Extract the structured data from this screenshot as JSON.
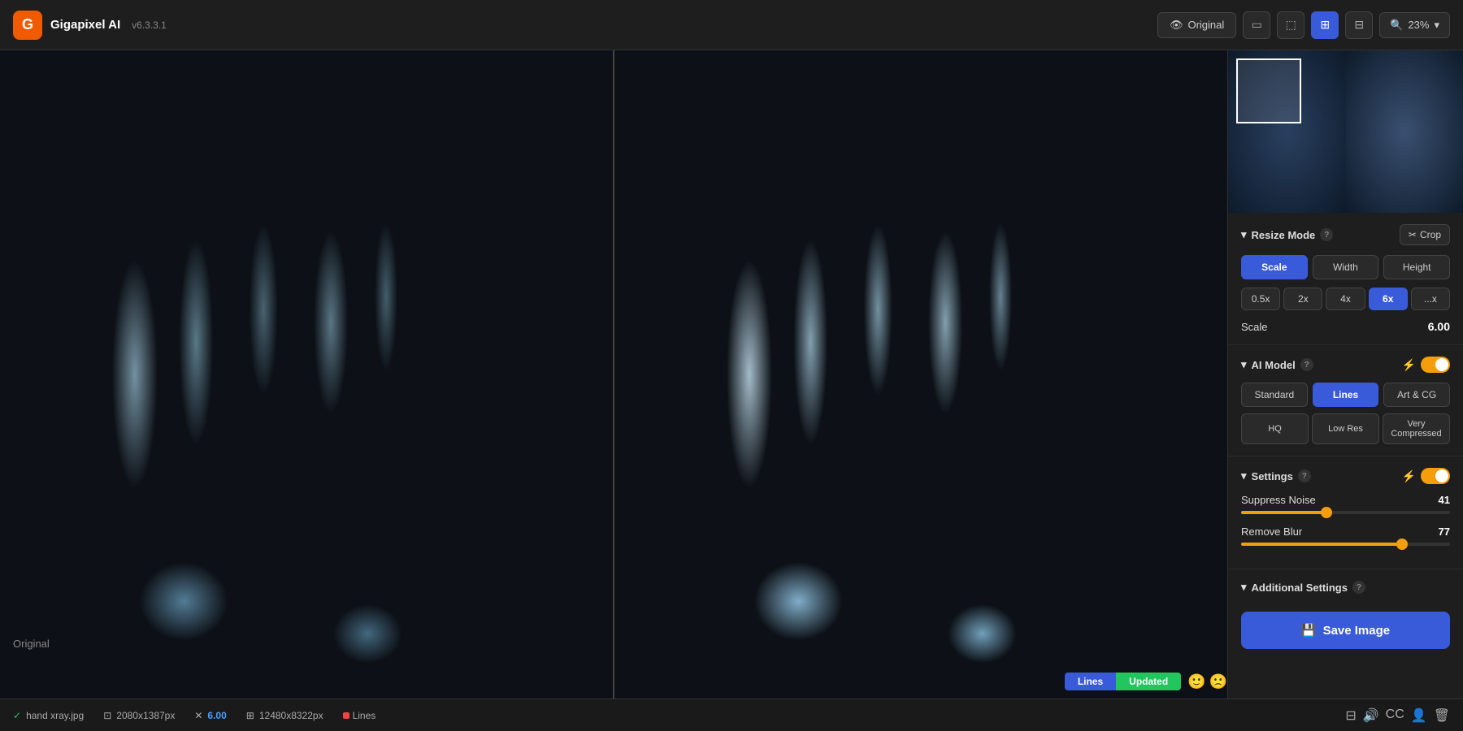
{
  "app": {
    "name": "Gigapixel AI",
    "version": "v6.3.3.1",
    "logo": "G"
  },
  "topbar": {
    "original_label": "Original",
    "zoom_label": "23%",
    "view_single_label": "single",
    "view_split_label": "split",
    "view_compare_label": "compare",
    "view_grid_label": "grid"
  },
  "resize_mode": {
    "title": "Resize Mode",
    "crop_label": "Crop",
    "scale_label": "Scale",
    "width_label": "Width",
    "height_label": "Height",
    "scale_0_5": "0.5x",
    "scale_2": "2x",
    "scale_4": "4x",
    "scale_6": "6x",
    "scale_custom": "...x",
    "scale_title": "Scale",
    "scale_value": "6.00"
  },
  "ai_model": {
    "title": "AI Model",
    "standard_label": "Standard",
    "lines_label": "Lines",
    "art_cg_label": "Art & CG",
    "hq_label": "HQ",
    "low_res_label": "Low Res",
    "very_compressed_label": "Very Compressed"
  },
  "settings": {
    "title": "Settings",
    "suppress_noise_label": "Suppress Noise",
    "suppress_noise_value": "41",
    "suppress_noise_percent": 41,
    "remove_blur_label": "Remove Blur",
    "remove_blur_value": "77",
    "remove_blur_percent": 77
  },
  "additional_settings": {
    "title": "Additional Settings"
  },
  "save_button": {
    "label": "Save Image"
  },
  "status_bar": {
    "filename": "hand xray.jpg",
    "original_size": "2080x1387px",
    "scale": "6.00",
    "output_size": "12480x8322px",
    "model": "Lines"
  },
  "image_area": {
    "original_label": "Original"
  },
  "model_badge": {
    "lines": "Lines",
    "updated": "Updated"
  }
}
